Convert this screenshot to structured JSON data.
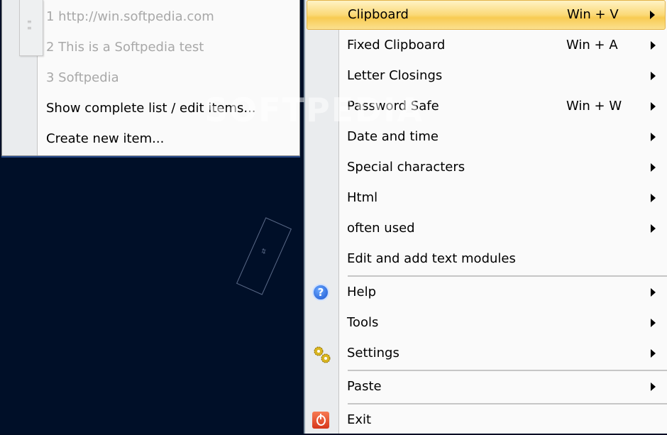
{
  "clipboard_submenu": {
    "pin_text": "≡",
    "items": [
      {
        "label": "1 http://win.softpedia.com",
        "disabled": true
      },
      {
        "label": "2 This is a Softpedia test",
        "disabled": true
      },
      {
        "label": "3 Softpedia",
        "disabled": true
      },
      {
        "label": "Show complete list / edit items...",
        "disabled": false
      },
      {
        "label": "Create new item...",
        "disabled": false
      }
    ]
  },
  "watermark": "SOFTPEDIA",
  "main_menu": {
    "items": [
      {
        "label": "Clipboard",
        "shortcut": "Win + V",
        "submenu": true,
        "highlighted": true
      },
      {
        "label": "Fixed Clipboard",
        "shortcut": "Win + A",
        "submenu": true
      },
      {
        "label": "Letter Closings",
        "shortcut": "",
        "submenu": true
      },
      {
        "label": "Password Safe",
        "shortcut": "Win + W",
        "submenu": true
      },
      {
        "label": "Date and time",
        "shortcut": "",
        "submenu": true
      },
      {
        "label": "Special characters",
        "shortcut": "",
        "submenu": true
      },
      {
        "label": "Html",
        "shortcut": "",
        "submenu": true
      },
      {
        "label": "often used",
        "shortcut": "",
        "submenu": true
      },
      {
        "label": "Edit and add text modules",
        "shortcut": "",
        "submenu": false
      },
      {
        "label": "Help",
        "shortcut": "",
        "submenu": true,
        "icon": "help-icon"
      },
      {
        "label": "Tools",
        "shortcut": "",
        "submenu": true
      },
      {
        "label": "Settings",
        "shortcut": "",
        "submenu": true,
        "icon": "gears-icon"
      },
      {
        "label": "Paste",
        "shortcut": "",
        "submenu": true
      },
      {
        "label": "Exit",
        "shortcut": "",
        "submenu": false,
        "icon": "exit-icon"
      }
    ]
  },
  "colors": {
    "highlight": "#fbd977",
    "desktop": "#000f28",
    "menu_bg": "#fafafa",
    "gutter": "#eaecee"
  }
}
